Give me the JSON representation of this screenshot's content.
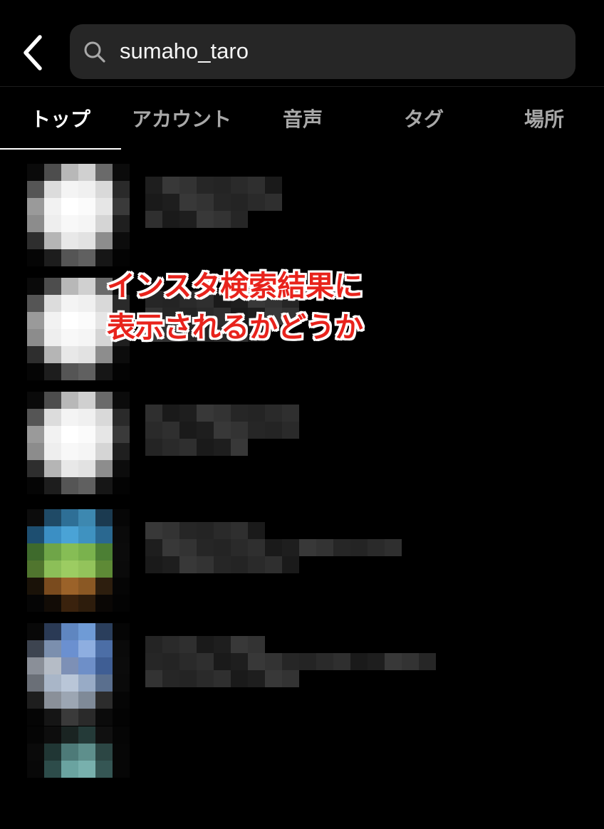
{
  "header": {
    "back_label": "戻る",
    "search": {
      "value": "sumaho_taro"
    }
  },
  "tabs": [
    {
      "label": "トップ",
      "active": true
    },
    {
      "label": "アカウント",
      "active": false
    },
    {
      "label": "音声",
      "active": false
    },
    {
      "label": "タグ",
      "active": false
    },
    {
      "label": "場所",
      "active": false
    }
  ],
  "annotation": {
    "line1": "インスタ検索結果に",
    "line2": "表示されるかどうか",
    "color": "#e8231c",
    "outline_color": "#ffffff"
  },
  "results": {
    "count_visible": 6,
    "blurred": true,
    "avatar_styles": [
      "white",
      "white",
      "white",
      "landscape",
      "blue",
      "teal"
    ]
  },
  "colors": {
    "background": "#000000",
    "search_bg": "#262626",
    "tab_active": "#ffffff",
    "tab_inactive": "#a8a8a8"
  }
}
